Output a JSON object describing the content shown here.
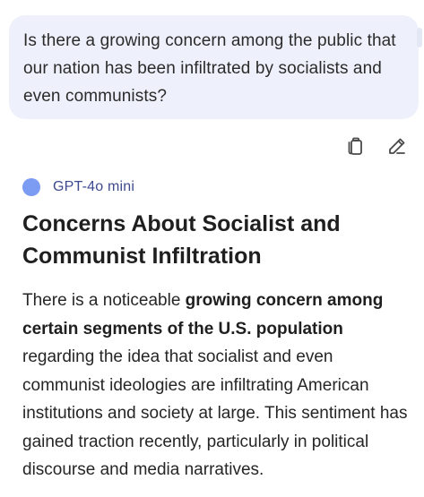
{
  "user_message": {
    "text": "Is there a growing concern among the public that our nation has been infiltrated by socialists and even communists?"
  },
  "actions": {
    "copy_icon": "clipboard-copy",
    "edit_icon": "pencil"
  },
  "model": {
    "name": "GPT-4o mini",
    "dot_color": "#7b9cf2"
  },
  "response": {
    "heading": "Concerns About Socialist and Communist Infiltration",
    "paragraph_start": "There is a noticeable ",
    "paragraph_bold": "growing concern among certain segments of the U.S. population",
    "paragraph_end": " regarding the idea that socialist and even communist ideologies are infiltrating American institutions and society at large. This sentiment has gained traction recently, particularly in political discourse and media narratives."
  },
  "colors": {
    "bubble_bg": "#eef1fb",
    "model_name": "#3d4a8f"
  }
}
